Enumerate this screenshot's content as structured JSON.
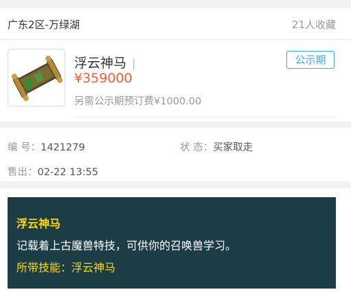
{
  "server": {
    "name": "广东2区-万绿湖",
    "favorites": "21人收藏"
  },
  "item": {
    "title": "浮云神马",
    "separator": "|",
    "price": "¥359000",
    "fee_note": "另需公示期预订费¥1000.00",
    "status_tag": "公示期",
    "thumbnail_icon": "scroll-item-icon"
  },
  "info": {
    "id_label": "编 号：",
    "id_value": "1421279",
    "state_label": "状 态：",
    "state_value": "买家取走",
    "sold_label": "售出：",
    "sold_value": "02-22 13:55"
  },
  "description": {
    "name": "浮云神马",
    "text": "记载着上古魔兽特技，可供你的召唤兽学习。",
    "skill": "所带技能：浮云神马"
  },
  "colors": {
    "price": "#ff5a2c",
    "tag": "#3fa9e0",
    "desc_bg": "#1d3d46",
    "desc_highlight": "#ffd900"
  }
}
